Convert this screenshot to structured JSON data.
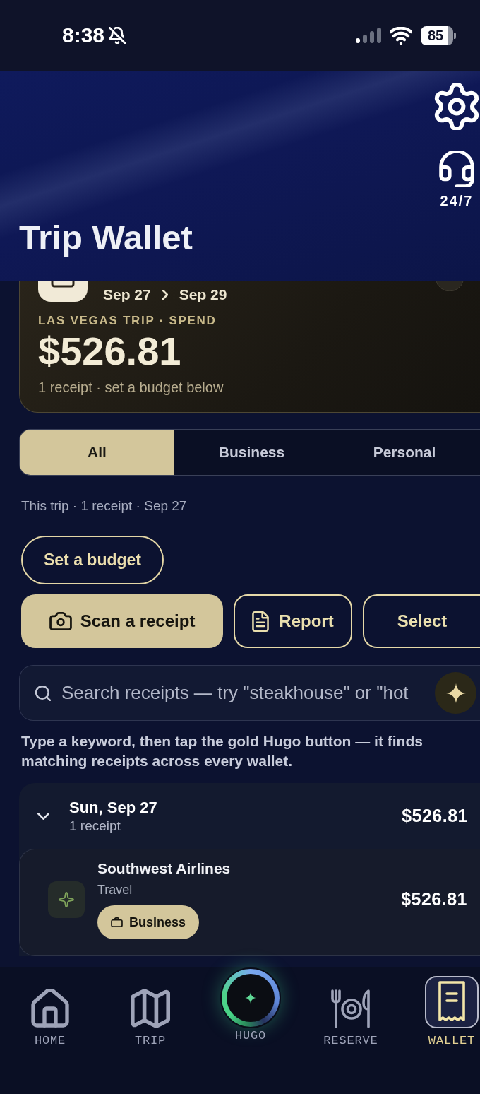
{
  "status_bar": {
    "time": "8:38",
    "battery": "85"
  },
  "header": {
    "title": "Trip Wallet",
    "support_label": "24/7"
  },
  "trip_card": {
    "start_date": "Sep 27",
    "end_date": "Sep 29",
    "label": "LAS VEGAS TRIP · SPEND",
    "amount": "$526.81",
    "summary": "1 receipt · set a budget below"
  },
  "filter_tabs": [
    {
      "label": "All",
      "selected": true
    },
    {
      "label": "Business",
      "selected": false
    },
    {
      "label": "Personal",
      "selected": false
    }
  ],
  "trip_summary": "This trip · 1 receipt · Sep 27",
  "budget_button": {
    "label": "Set a budget"
  },
  "actions": [
    {
      "kind": "scan",
      "label": "Scan a receipt"
    },
    {
      "kind": "report",
      "label": "Report"
    },
    {
      "kind": "select",
      "label": "Select"
    }
  ],
  "search": {
    "placeholder": "Search receipts — try \"steakhouse\" or \"hot"
  },
  "search_hint": "Type a keyword, then tap the gold Hugo button — it finds matching receipts across every wallet.",
  "day_groups": [
    {
      "date": "Sun, Sep 27",
      "count": "1 receipt",
      "total": "$526.81",
      "expanded": true,
      "receipts": [
        {
          "merchant": "Southwest Airlines",
          "category": "Travel",
          "tag": "Business",
          "amount": "$526.81"
        }
      ]
    }
  ],
  "tab_bar": [
    {
      "kind": "home",
      "label": "HOME",
      "selected": false
    },
    {
      "kind": "trip",
      "label": "TRIP",
      "selected": false
    },
    {
      "kind": "hugo",
      "label": "HUGO",
      "selected": false
    },
    {
      "kind": "reserve",
      "label": "RESERVE",
      "selected": false
    },
    {
      "kind": "wallet",
      "label": "WALLET",
      "selected": true
    }
  ]
}
